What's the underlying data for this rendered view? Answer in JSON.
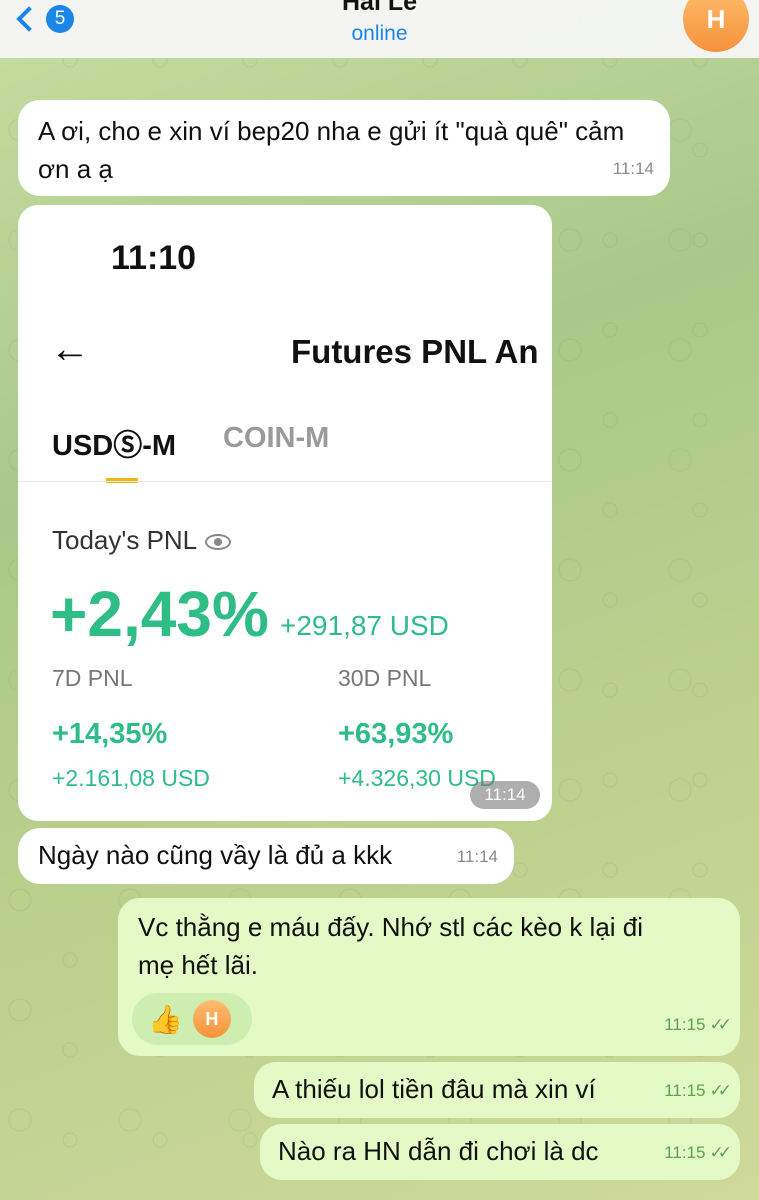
{
  "header": {
    "back_count": "5",
    "title": "Hai Le",
    "status": "online",
    "avatar_initial": "H"
  },
  "messages": {
    "m1": {
      "text": "A ơi, cho e xin ví bep20 nha e gửi ít \"quà quê\" cảm ơn a ạ",
      "time": "11:14"
    },
    "shot": {
      "time": "11:14",
      "clock": "11:10",
      "heading": "Futures PNL An",
      "tab_usd": "USDⓈ-M",
      "tab_coin": "COIN-M",
      "today_label": "Today's PNL",
      "today_pct": "+2,43%",
      "today_usd": "+291,87 USD",
      "d7_label": "7D PNL",
      "d7_pct": "+14,35%",
      "d7_usd": "+2.161,08 USD",
      "d30_label": "30D PNL",
      "d30_pct": "+63,93%",
      "d30_usd": "+4.326,30 USD"
    },
    "m2": {
      "text": "Ngày nào cũng vầy là đủ a kkk",
      "time": "11:14"
    },
    "m3": {
      "line1": "Vc thằng e máu đấy. Nhớ stl các kèo k lại đi",
      "line2": "mẹ hết lãi.",
      "time": "11:15",
      "reaction_emoji": "👍",
      "reaction_initial": "H"
    },
    "m4": {
      "text": "A thiếu lol tiền đâu mà xin ví",
      "time": "11:15"
    },
    "m5": {
      "text": "Nào ra HN dẫn đi chơi là dc",
      "time": "11:15"
    }
  },
  "colors": {
    "accent": "#1a86e8",
    "positive": "#2ebd85",
    "outgoing_bubble": "#e3f9c6"
  }
}
